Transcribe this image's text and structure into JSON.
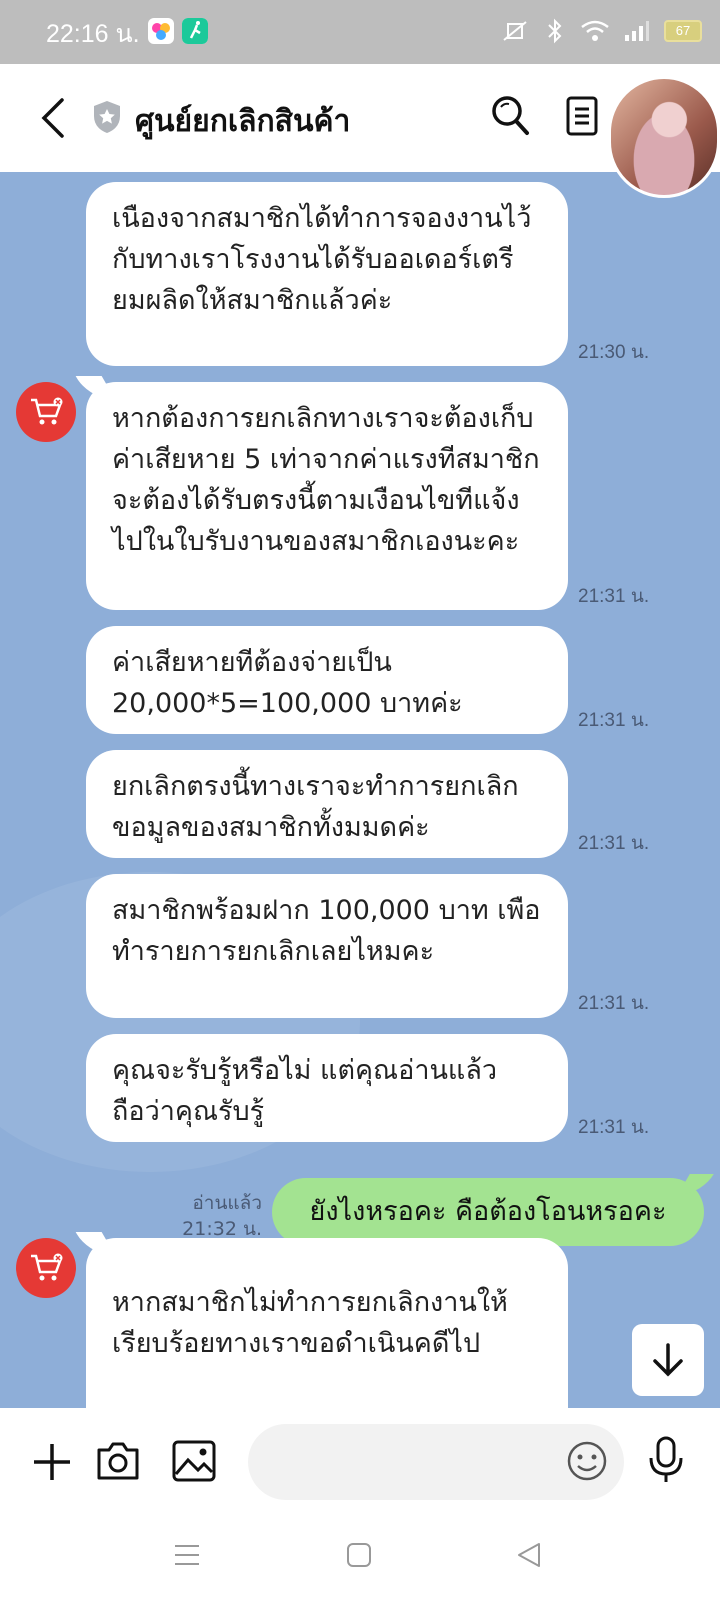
{
  "status_bar": {
    "time": "22:16 น.",
    "battery": "67"
  },
  "header": {
    "title": "ศูนย์ยกเลิกสินค้า"
  },
  "messages": [
    {
      "text": "เนืองจากสมาชิกได้ทำการจองงานไว้กับทางเราโรงงานได้รับออเดอร์เตรียมผลิดให้สมาชิกแล้วค่ะ",
      "time": "21:30 น."
    },
    {
      "text": "หากต้องการยกเลิกทางเราจะต้องเก็บค่าเสียหาย 5 เท่าจากค่าแรงทีสมาชิกจะต้องได้รับตรงนี้ตามเงือนไขทีแจ้งไปในใบรับงานของสมาชิกเองนะคะ",
      "time": "21:31 น."
    },
    {
      "text": "ค่าเสียหายทีต้องจ่ายเป็น 20,000*5=100,000 บาทค่ะ",
      "time": "21:31 น."
    },
    {
      "text": "ยกเลิกตรงนี้ทางเราจะทำการยกเลิกขอมูลของสมาชิกทั้งมมดค่ะ",
      "time": "21:31 น."
    },
    {
      "text": "สมาชิกพร้อมฝาก 100,000 บาท เพือทำรายการยกเลิกเลยไหมคะ",
      "time": "21:31 น."
    },
    {
      "text": "คุณจะรับรู้หรือไม่ แต่คุณอ่านแล้วถือว่าคุณรับรู้",
      "time": "21:31 น."
    },
    {
      "text": "หากสมาชิกไม่ทำการยกเลิกงานให้เรียบร้อยทางเราขอดำเนินคดีไป",
      "time": ""
    }
  ],
  "outgoing": {
    "text": "ยังไงหรอคะ คือต้องโอนหรอคะ",
    "read_label": "อ่านแล้ว",
    "time": "21:32 น."
  },
  "input": {
    "placeholder": ""
  },
  "icons": {
    "back": "back-arrow-icon",
    "shield": "shield-icon",
    "search": "search-icon",
    "menu": "menu-icon",
    "plus": "plus-icon",
    "camera": "camera-icon",
    "image": "image-icon",
    "emoji": "emoji-icon",
    "mic": "mic-icon",
    "cart": "cart-icon",
    "scroll_down": "arrow-down-icon"
  },
  "colors": {
    "chat_bg": "#8eaed8",
    "outgoing_bubble": "#a3e391",
    "avatar_red": "#e53935"
  }
}
